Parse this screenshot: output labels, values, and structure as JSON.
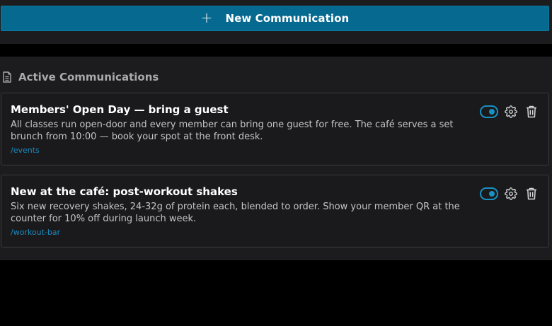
{
  "toolbar": {
    "new_button_icon": "plus-icon",
    "new_button_label": "New Communication"
  },
  "section": {
    "icon": "document-icon",
    "title": "Active Communications"
  },
  "communications": [
    {
      "title": "Members' Open Day — bring a guest",
      "body": "All classes run open-door and every member can bring one guest for free. The café serves a set brunch from 10:00 — book your spot at the front desk.",
      "link": "/events",
      "enabled": true
    },
    {
      "title": "New at the café: post-workout shakes",
      "body": "Six new recovery shakes, 24-32g of protein each, blended to order. Show your member QR at the counter for 10% off during launch week.",
      "link": "/workout-bar",
      "enabled": true
    }
  ],
  "colors": {
    "accent": "#06698f",
    "toggle": "#1891c4",
    "link": "#1a8bc0",
    "panel": "#1c1c1e",
    "card": "#1a1a1c"
  }
}
